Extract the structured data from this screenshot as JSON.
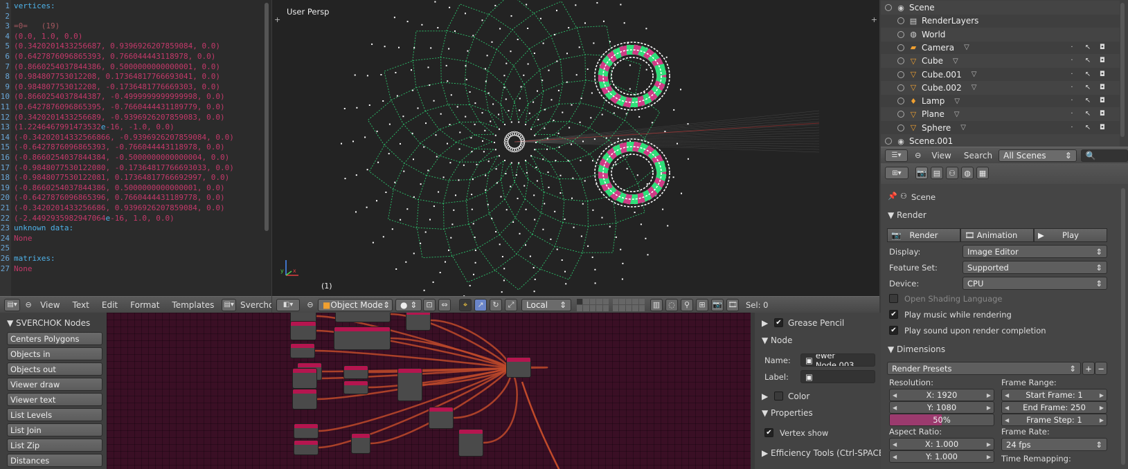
{
  "text_editor": {
    "lines": [
      {
        "n": "1",
        "parts": [
          {
            "t": "vertices:",
            "c": "key"
          }
        ]
      },
      {
        "n": "2",
        "parts": []
      },
      {
        "n": "3",
        "parts": [
          {
            "t": "=0=   (19)",
            "c": "dim"
          }
        ]
      },
      {
        "n": "4",
        "parts": [
          {
            "t": "(0.0, 1.0, 0.0)",
            "c": "val"
          }
        ]
      },
      {
        "n": "5",
        "parts": [
          {
            "t": "(0.3420201433256687, 0.9396926207859084, 0.0)",
            "c": "val"
          }
        ]
      },
      {
        "n": "6",
        "parts": [
          {
            "t": "(0.6427876096865393, 0.766044443118978, 0.0)",
            "c": "val"
          }
        ]
      },
      {
        "n": "7",
        "parts": [
          {
            "t": "(0.8660254037844386, 0.5000000000000001, 0.0)",
            "c": "val"
          }
        ]
      },
      {
        "n": "8",
        "parts": [
          {
            "t": "(0.984807753012208, 0.17364817766693041, 0.0)",
            "c": "val"
          }
        ]
      },
      {
        "n": "9",
        "parts": [
          {
            "t": "(0.984807753012208, -0.1736481776669303, 0.0)",
            "c": "val"
          }
        ]
      },
      {
        "n": "10",
        "parts": [
          {
            "t": "(0.8660254037844387, -0.4999999999999998, 0.0)",
            "c": "val"
          }
        ]
      },
      {
        "n": "11",
        "parts": [
          {
            "t": "(0.6427876096865395, -0.7660444431189779, 0.0)",
            "c": "val"
          }
        ]
      },
      {
        "n": "12",
        "parts": [
          {
            "t": "(0.3420201433256689, -0.9396926207859083, 0.0)",
            "c": "val"
          }
        ]
      },
      {
        "n": "13",
        "parts": [
          {
            "t": "(1.2246467991473532",
            "c": "val"
          },
          {
            "t": "e",
            "c": "key"
          },
          {
            "t": "-16, -1.0, 0.0)",
            "c": "val"
          }
        ]
      },
      {
        "n": "14",
        "parts": [
          {
            "t": "(-0.34202014332566866, -0.9396926207859084, 0.0)",
            "c": "val"
          }
        ]
      },
      {
        "n": "15",
        "parts": [
          {
            "t": "(-0.6427876096865393, -0.766044443118978, 0.0)",
            "c": "val"
          }
        ]
      },
      {
        "n": "16",
        "parts": [
          {
            "t": "(-0.8660254037844384, -0.5000000000000004, 0.0)",
            "c": "val"
          }
        ]
      },
      {
        "n": "17",
        "parts": [
          {
            "t": "(-0.9848077530122080, -0.17364817766693033, 0.0)",
            "c": "val"
          }
        ]
      },
      {
        "n": "18",
        "parts": [
          {
            "t": "(-0.9848077530122081, 0.17364817766692997, 0.0)",
            "c": "val"
          }
        ]
      },
      {
        "n": "19",
        "parts": [
          {
            "t": "(-0.8660254037844386, 0.5000000000000001, 0.0)",
            "c": "val"
          }
        ]
      },
      {
        "n": "20",
        "parts": [
          {
            "t": "(-0.6427876096865396, 0.7660444431189778, 0.0)",
            "c": "val"
          }
        ]
      },
      {
        "n": "21",
        "parts": [
          {
            "t": "(-0.3420201433256686, 0.9396926207859084, 0.0)",
            "c": "val"
          }
        ]
      },
      {
        "n": "22",
        "parts": [
          {
            "t": "(-2.4492935982947064",
            "c": "val"
          },
          {
            "t": "e",
            "c": "key"
          },
          {
            "t": "-16, 1.0, 0.0)",
            "c": "val"
          }
        ]
      },
      {
        "n": "23",
        "parts": [
          {
            "t": "unknown data:",
            "c": "key"
          }
        ]
      },
      {
        "n": "24",
        "parts": [
          {
            "t": "None",
            "c": "val"
          }
        ]
      },
      {
        "n": "25",
        "parts": []
      },
      {
        "n": "26",
        "parts": [
          {
            "t": "matrixes:",
            "c": "key"
          }
        ]
      },
      {
        "n": "27",
        "parts": [
          {
            "t": "None",
            "c": "val"
          }
        ]
      }
    ],
    "header": {
      "menus": [
        "View",
        "Text",
        "Edit",
        "Format",
        "Templates"
      ],
      "file_name": "Sverchok_vie"
    }
  },
  "viewport": {
    "label": "User Persp",
    "frame": "(1)",
    "header": {
      "mode": "Object Mode",
      "pivot": "Local",
      "sel": "Sel: 0"
    },
    "colors": {
      "bg": "#232323",
      "green": "#2fe07a",
      "pink": "#d03b86",
      "white": "#ffffff"
    }
  },
  "outliner": {
    "items": [
      {
        "label": "Scene",
        "icon": "scene-icon",
        "level": 0
      },
      {
        "label": "RenderLayers",
        "icon": "render-layers-icon",
        "level": 1
      },
      {
        "label": "World",
        "icon": "world-icon",
        "level": 1
      },
      {
        "label": "Camera",
        "icon": "camera-icon",
        "level": 1
      },
      {
        "label": "Cube",
        "icon": "mesh-icon",
        "level": 1
      },
      {
        "label": "Cube.001",
        "icon": "mesh-icon",
        "level": 1
      },
      {
        "label": "Cube.002",
        "icon": "mesh-icon",
        "level": 1
      },
      {
        "label": "Lamp",
        "icon": "lamp-icon",
        "level": 1
      },
      {
        "label": "Plane",
        "icon": "mesh-icon",
        "level": 1
      },
      {
        "label": "Sphere",
        "icon": "mesh-icon",
        "level": 1
      },
      {
        "label": "Scene.001",
        "icon": "scene-icon",
        "level": 0
      }
    ],
    "header": {
      "view": "View",
      "search": "Search",
      "filter": "All Scenes"
    }
  },
  "properties": {
    "context": "Scene",
    "render_panel": "Render",
    "render_btn": "Render",
    "animation_btn": "Animation",
    "play_btn": "Play",
    "display_label": "Display:",
    "display_value": "Image Editor",
    "feature_label": "Feature Set:",
    "feature_value": "Supported",
    "device_label": "Device:",
    "device_value": "CPU",
    "osl_label": "Open Shading Language",
    "play_music_label": "Play music while rendering",
    "play_sound_label": "Play sound upon render completion",
    "dimensions_panel": "Dimensions",
    "render_presets": "Render Presets",
    "resolution_label": "Resolution:",
    "res_x": "X: 1920",
    "res_y": "Y: 1080",
    "res_pct": "50%",
    "res_pct_fraction": 0.5,
    "aspect_label": "Aspect Ratio:",
    "aspect_x": "X: 1.000",
    "aspect_y": "Y: 1.000",
    "frame_range_label": "Frame Range:",
    "start_frame": "Start Frame: 1",
    "end_frame": "End Frame: 250",
    "frame_step": "Frame Step: 1",
    "frame_rate_label": "Frame Rate:",
    "frame_rate": "24 fps",
    "time_remap_label": "Time Remapping:"
  },
  "node_tools": {
    "title": "SVERCHOK Nodes",
    "buttons": [
      "Centers Polygons",
      "Objects in",
      "Objects out",
      "Viewer draw",
      "Viewer text",
      "List Levels",
      "List Join",
      "List Zip",
      "Distances"
    ]
  },
  "node_sidebar": {
    "grease_pencil": "Grease Pencil",
    "node_panel": "Node",
    "name_label": "Name:",
    "name_value": "ewer Node.003",
    "label_label": "Label:",
    "color_panel": "Color",
    "properties_panel": "Properties",
    "vertex_show": "Vertex show",
    "efficiency_tools": "Efficiency Tools (Ctrl-SPACE"
  }
}
